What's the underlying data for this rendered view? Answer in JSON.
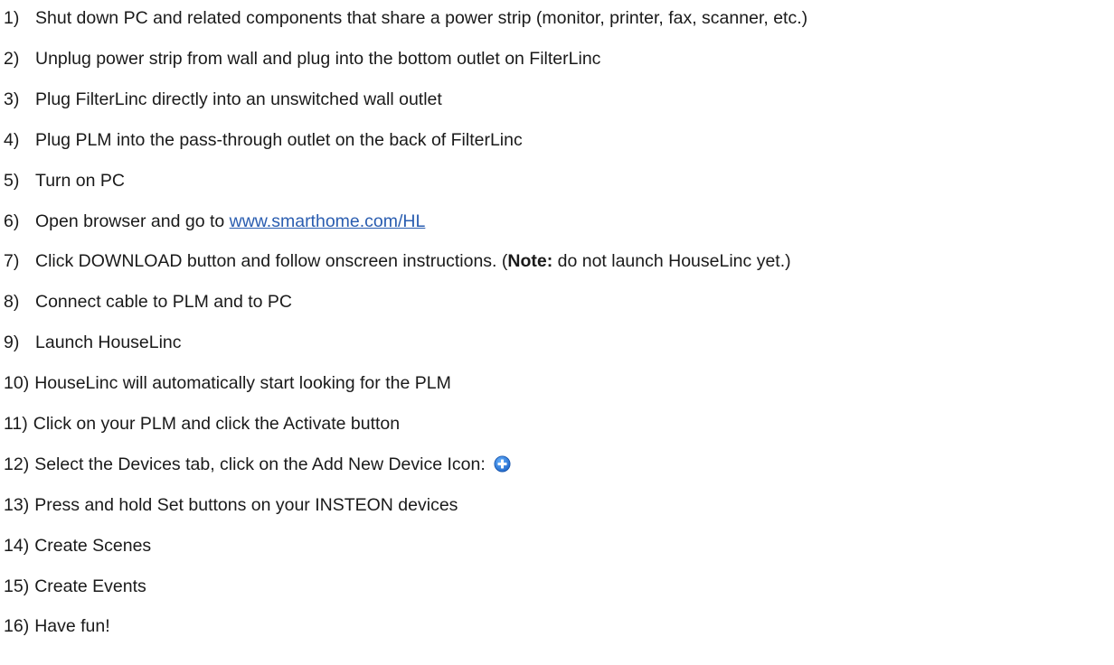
{
  "steps": [
    {
      "num": "1)",
      "text": "Shut down PC and related components that share a power strip (monitor, printer, fax, scanner, etc.)"
    },
    {
      "num": "2)",
      "text": "Unplug power strip from wall and plug into the bottom outlet on FilterLinc"
    },
    {
      "num": "3)",
      "text": "Plug FilterLinc directly into an unswitched wall outlet"
    },
    {
      "num": "4)",
      "text": "Plug PLM into the pass-through outlet on the back of FilterLinc"
    },
    {
      "num": "5)",
      "text": "Turn on PC"
    },
    {
      "num": "6)",
      "text": "Open browser and go to ",
      "link": "www.smarthome.com/HL"
    },
    {
      "num": "7)",
      "text_before": "Click DOWNLOAD button and follow onscreen instructions. (",
      "note_label": "Note:",
      "text_after": " do not launch HouseLinc yet.)"
    },
    {
      "num": "8)",
      "text": "Connect cable to PLM and to PC"
    },
    {
      "num": "9)",
      "text": "Launch HouseLinc"
    },
    {
      "num": "10)",
      "text": "HouseLinc will automatically start looking for the PLM"
    },
    {
      "num": "11)",
      "text": "Click on your PLM and click the Activate button"
    },
    {
      "num": "12)",
      "text": "Select the Devices tab, click on the Add New Device Icon: ",
      "icon": "add-new-device-icon"
    },
    {
      "num": "13)",
      "text": "Press and hold Set buttons on your INSTEON devices"
    },
    {
      "num": "14)",
      "text": "Create Scenes"
    },
    {
      "num": "15)",
      "text": "Create Events"
    },
    {
      "num": "16)",
      "text": "Have fun!"
    }
  ],
  "colors": {
    "text": "#1a1a1a",
    "link": "#2a5db0",
    "icon_fill": "#2f7fd9"
  }
}
